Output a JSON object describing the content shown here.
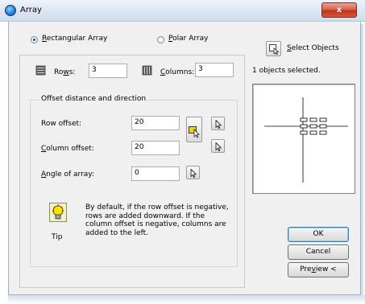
{
  "window": {
    "title": "Array",
    "close_glyph": "x"
  },
  "array_type": {
    "rectangular_label": "Rectangular Array",
    "polar_label": "Polar Array",
    "selected": "rectangular"
  },
  "select_objects": {
    "label": "Select Objects",
    "status": "1 objects selected."
  },
  "rows": {
    "label": "Rows:",
    "value": "3"
  },
  "columns": {
    "label": "Columns:",
    "value": "3"
  },
  "offset_group": {
    "caption": "Offset distance and direction",
    "row_offset_label": "Row offset:",
    "row_offset_value": "20",
    "column_offset_label": "Column offset:",
    "column_offset_value": "20",
    "angle_label": "Angle of array:",
    "angle_value": "0"
  },
  "tip": {
    "label": "Tip",
    "text": "By default, if the row offset is negative, rows are added downward.  If the column offset is negative, columns are added to the left."
  },
  "buttons": {
    "ok": "OK",
    "cancel": "Cancel",
    "preview": "Preview <"
  }
}
